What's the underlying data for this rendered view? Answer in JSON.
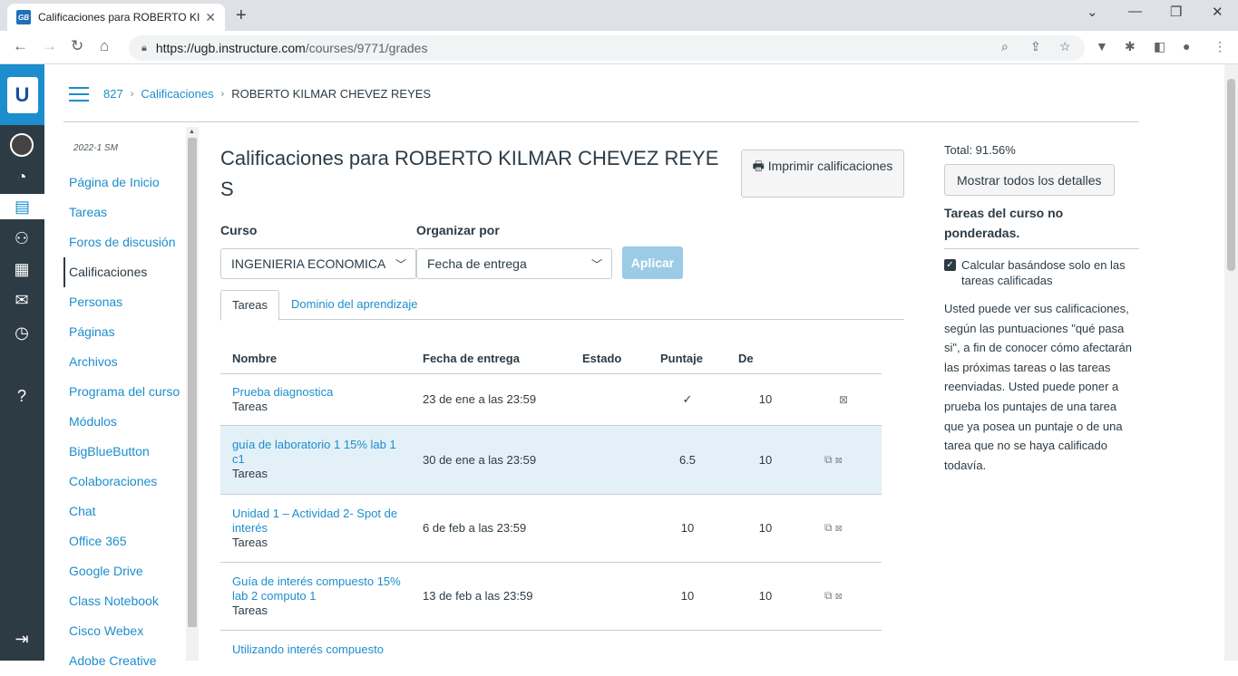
{
  "browser": {
    "tab_title": "Calificaciones para ROBERTO KILI",
    "favicon_text": "GB",
    "url_host": "https://ugb.instructure.com",
    "url_path": "/courses/9771/grades"
  },
  "breadcrumb": {
    "course": "827",
    "section": "Calificaciones",
    "current": "ROBERTO KILMAR CHEVEZ REYES"
  },
  "course_nav": {
    "term": "2022-1 SM",
    "items": [
      "Página de Inicio",
      "Tareas",
      "Foros de discusión",
      "Calificaciones",
      "Personas",
      "Páginas",
      "Archivos",
      "Programa del curso",
      "Módulos",
      "BigBlueButton",
      "Colaboraciones",
      "Chat",
      "Office 365",
      "Google Drive",
      "Class Notebook",
      "Cisco Webex",
      "Adobe Creative"
    ]
  },
  "page": {
    "title": "Calificaciones para ROBERTO KILMAR CHEVEZ REYES",
    "print_button": "Imprimir calificaciones",
    "course_label": "Curso",
    "course_value": "INGENIERIA ECONOMICA",
    "sort_label": "Organizar por",
    "sort_value": "Fecha de entrega",
    "apply_button": "Aplicar",
    "tab_assignments": "Tareas",
    "tab_mastery": "Dominio del aprendizaje"
  },
  "table": {
    "headers": [
      "Nombre",
      "Fecha de entrega",
      "Estado",
      "Puntaje",
      "De"
    ],
    "rows": [
      {
        "name": "Prueba diagnostica",
        "category": "Tareas",
        "due": "23 de ene a las 23:59",
        "status": "",
        "score": "✓",
        "of": "10"
      },
      {
        "name": "guía de laboratorio 1 15% lab 1 c1",
        "category": "Tareas",
        "due": "30 de ene a las 23:59",
        "status": "",
        "score": "6.5",
        "of": "10"
      },
      {
        "name": "Unidad 1 – Actividad 2- Spot de interés",
        "category": "Tareas",
        "due": "6 de feb a las 23:59",
        "status": "",
        "score": "10",
        "of": "10"
      },
      {
        "name": "Guía de interés compuesto 15% lab 2 computo 1",
        "category": "Tareas",
        "due": "13 de feb a las 23:59",
        "status": "",
        "score": "10",
        "of": "10"
      },
      {
        "name": "Utilizando interés compuesto",
        "category": "",
        "due": "",
        "status": "",
        "score": "",
        "of": ""
      }
    ]
  },
  "sidebar": {
    "total": "Total: 91.56%",
    "show_all_button": "Mostrar todos los detalles",
    "unweighted": "Tareas del curso no ponderadas.",
    "checkbox_label": "Calcular basándose solo en las tareas calificadas",
    "info": "Usted puede ver sus calificaciones, según las puntuaciones \"qué pasa si\", a fin de conocer cómo afectarán las próximas tareas o las tareas reenviadas. Usted puede poner a prueba los puntajes de una tarea que ya posea un puntaje o de una tarea que no se haya calificado todavía."
  }
}
